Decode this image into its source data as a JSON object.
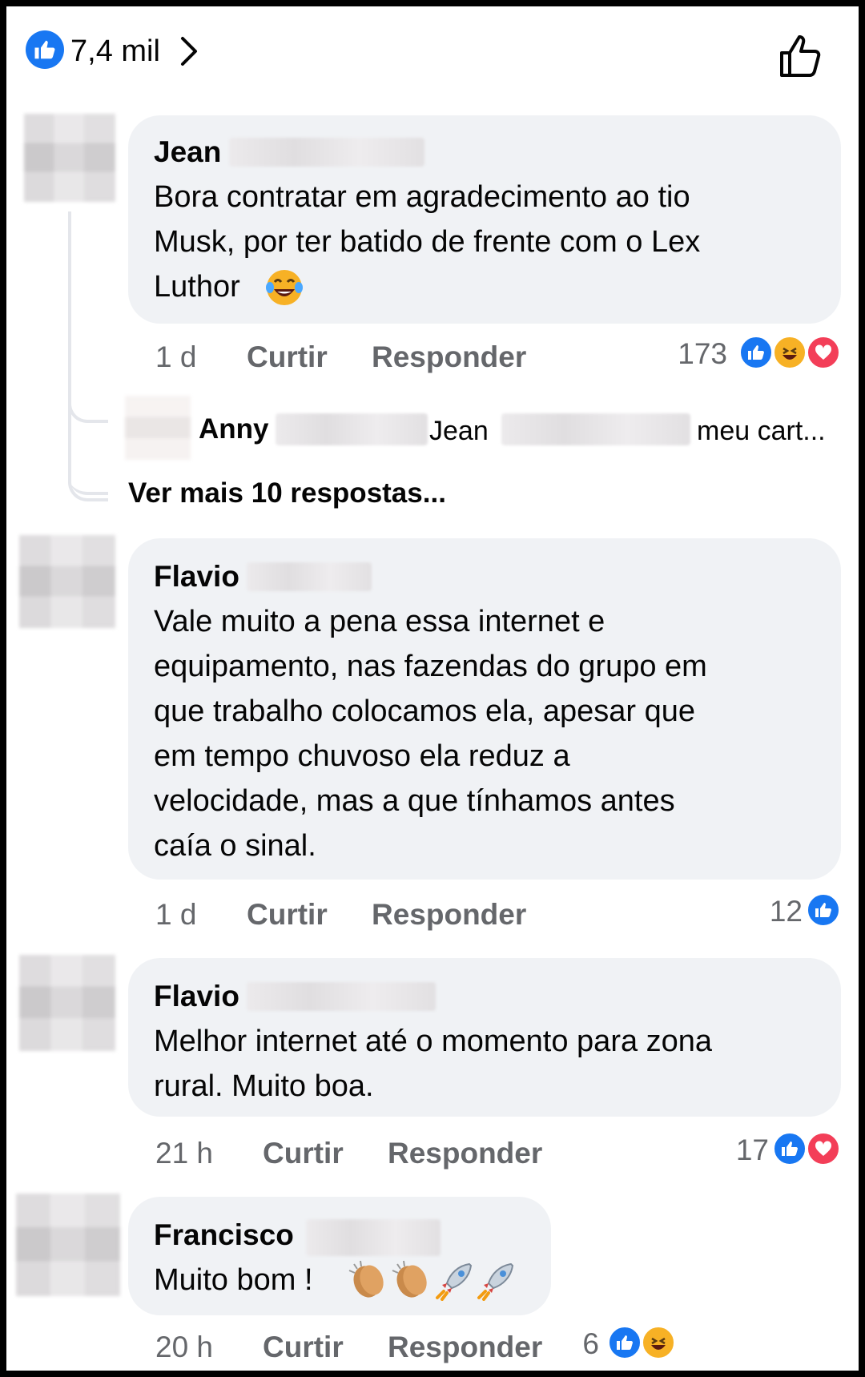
{
  "header": {
    "like_count": "7,4 mil"
  },
  "comments": [
    {
      "name": "Jean",
      "text_lines": [
        "Bora contratar em agradecimento ao tio",
        "Musk, por ter batido de frente com o Lex",
        "Luthor"
      ],
      "time": "1 d",
      "like_label": "Curtir",
      "reply_label": "Responder",
      "reaction_count": "173",
      "reactions": [
        "like-icon",
        "haha-icon",
        "love-icon"
      ],
      "reply": {
        "name": "Anny",
        "mention": "Jean",
        "text": "meu cart..."
      },
      "more_replies": "Ver mais 10 respostas..."
    },
    {
      "name": "Flavio",
      "text_lines": [
        "Vale muito a pena essa internet e",
        "equipamento, nas fazendas do grupo em",
        "que trabalho colocamos ela, apesar que",
        "em tempo chuvoso ela reduz a",
        "velocidade, mas a que tínhamos antes",
        "caía o sinal."
      ],
      "time": "1 d",
      "like_label": "Curtir",
      "reply_label": "Responder",
      "reaction_count": "12",
      "reactions": [
        "like-icon"
      ]
    },
    {
      "name": "Flavio",
      "text_lines": [
        "Melhor internet até o momento para zona",
        "rural. Muito boa."
      ],
      "time": "21 h",
      "like_label": "Curtir",
      "reply_label": "Responder",
      "reaction_count": "17",
      "reactions": [
        "like-icon",
        "love-icon"
      ]
    },
    {
      "name": "Francisco",
      "text_lines": [
        "Muito bom !"
      ],
      "time": "20 h",
      "like_label": "Curtir",
      "reply_label": "Responder",
      "reaction_count": "6",
      "reactions": [
        "like-icon",
        "haha-icon"
      ]
    }
  ],
  "colors": {
    "like_blue": "#1877f2",
    "love_red": "#f33e58",
    "haha_yellow": "#f7b125",
    "bubble_bg": "#f0f2f5",
    "meta_gray": "#65676b"
  }
}
